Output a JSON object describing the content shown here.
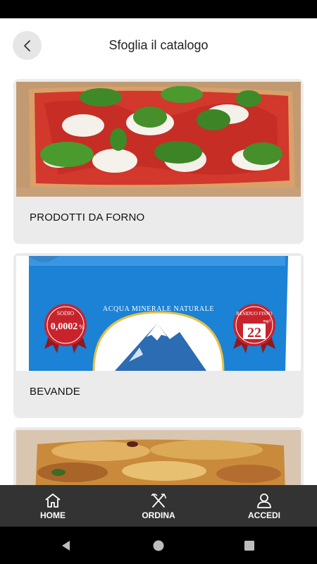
{
  "header": {
    "title": "Sfoglia il catalogo"
  },
  "catalog": {
    "items": [
      {
        "label": "PRODOTTI DA FORNO",
        "image": "pizza-photo"
      },
      {
        "label": "BEVANDE",
        "image": "water-bottle-photo"
      },
      {
        "label": "",
        "image": "lasagna-photo"
      }
    ],
    "water_label": {
      "brand_arc": "ACQUA MINERALE NATURALE",
      "sodio_title": "SODIO",
      "sodio_value": "0,0002",
      "sodio_unit": "%",
      "residuo_title": "RESIDUO FISSO",
      "residuo_unit": "mg/l",
      "residuo_value": "22"
    }
  },
  "bottom_nav": {
    "items": [
      {
        "label": "HOME",
        "icon": "home-icon"
      },
      {
        "label": "ORDINA",
        "icon": "cutlery-icon"
      },
      {
        "label": "ACCEDI",
        "icon": "user-icon"
      }
    ]
  },
  "colors": {
    "nav_bg": "#333333",
    "card_bg": "#ebebeb",
    "bottle_blue": "#1b82d6",
    "seal_red": "#c8232c"
  }
}
